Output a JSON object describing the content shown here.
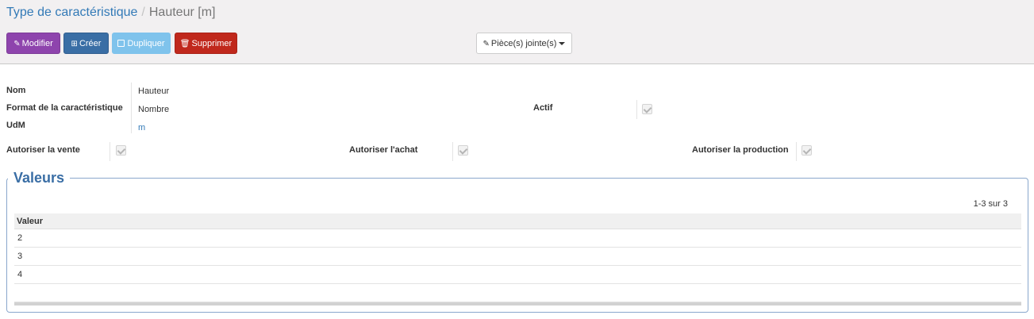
{
  "breadcrumb": {
    "parent": "Type de caractéristique",
    "separator": "/",
    "current": "Hauteur [m]"
  },
  "toolbar": {
    "edit_label": "Modifier",
    "create_label": "Créer",
    "duplicate_label": "Dupliquer",
    "delete_label": "Supprimer",
    "attachments_label": "Pièce(s) jointe(s)"
  },
  "form": {
    "name_label": "Nom",
    "name_value": "Hauteur",
    "format_label": "Format de la caractéristique",
    "format_value": "Nombre",
    "uom_label": "UdM",
    "uom_value": "m",
    "active_label": "Actif",
    "active_checked": true,
    "sale_label": "Autoriser la vente",
    "sale_checked": true,
    "purchase_label": "Autoriser l'achat",
    "purchase_checked": true,
    "production_label": "Autoriser la production",
    "production_checked": true
  },
  "values_section": {
    "title": "Valeurs",
    "pager": "1-3 sur 3",
    "column_header": "Valeur",
    "rows": [
      "2",
      "3",
      "4"
    ]
  },
  "colors": {
    "edit": "#8e44ad",
    "create": "#3a6ea5",
    "duplicate": "#7fc3ec",
    "delete": "#c0281c",
    "link": "#337ab7"
  }
}
